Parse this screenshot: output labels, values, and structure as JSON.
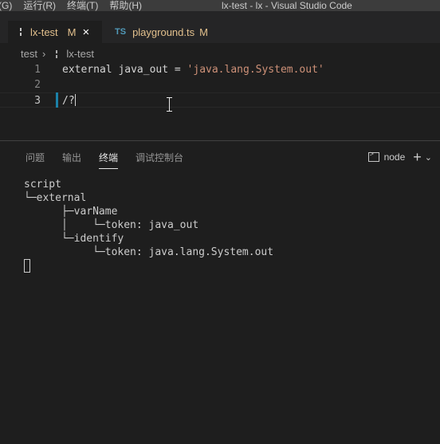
{
  "titlebar": {
    "menu": [
      "(G)",
      "运行(R)",
      "终端(T)",
      "帮助(H)"
    ],
    "window_title": "lx-test - lx - Visual Studio Code"
  },
  "tabs": [
    {
      "name": "lx-test",
      "modified": "M",
      "close": "×",
      "icon": "file-icon"
    },
    {
      "name": "playground.ts",
      "modified": "M",
      "badge": "TS",
      "icon": "ts-icon"
    }
  ],
  "breadcrumb": {
    "root": "test",
    "sep": "›",
    "file": "lx-test"
  },
  "editor": {
    "lines": [
      {
        "n": "1",
        "pre": "external java_out = ",
        "str": "'java.lang.System.out'"
      },
      {
        "n": "2",
        "pre": "",
        "str": ""
      },
      {
        "n": "3",
        "pre": "/?",
        "str": ""
      }
    ]
  },
  "panel": {
    "tabs": [
      "问题",
      "输出",
      "终端",
      "调试控制台"
    ],
    "active_tab": "终端",
    "shell": "node",
    "plus": "+",
    "chevron": "⌄"
  },
  "terminal": {
    "lines": [
      "script",
      "└─external",
      "      ├─varName",
      "      │    └─token: java_out",
      "      └─identify",
      "           └─token: java.lang.System.out"
    ]
  }
}
